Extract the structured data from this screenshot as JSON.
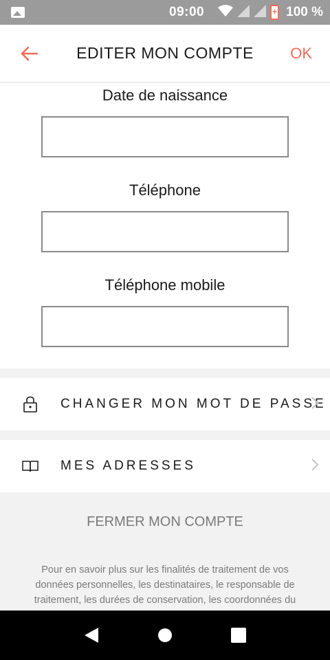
{
  "status_bar": {
    "time": "09:00",
    "battery_percent": "100 %",
    "icons": [
      "image-icon",
      "wifi-icon",
      "signal-icon",
      "battery-icon"
    ]
  },
  "app_bar": {
    "title": "EDITER MON COMPTE",
    "ok_label": "OK",
    "accent_color": "#f26a57"
  },
  "form": {
    "fields": [
      {
        "label": "Date de naissance",
        "value": ""
      },
      {
        "label": "Téléphone",
        "value": ""
      },
      {
        "label": "Téléphone mobile",
        "value": ""
      }
    ]
  },
  "menu": {
    "change_password": {
      "label": "CHANGER MON MOT DE PASSE",
      "icon": "lock-icon"
    },
    "addresses": {
      "label": "MES ADRESSES",
      "icon": "book-icon"
    }
  },
  "close_account_label": "FERMER MON COMPTE",
  "info_text": "Pour en savoir plus sur les finalités de traitement de vos données personnelles, les destinataires, le responsable de traitement, les durées de conservation, les coordonnées du",
  "nav_bar": {
    "buttons": [
      "back-triangle-icon",
      "home-circle-icon",
      "recents-square-icon"
    ]
  }
}
